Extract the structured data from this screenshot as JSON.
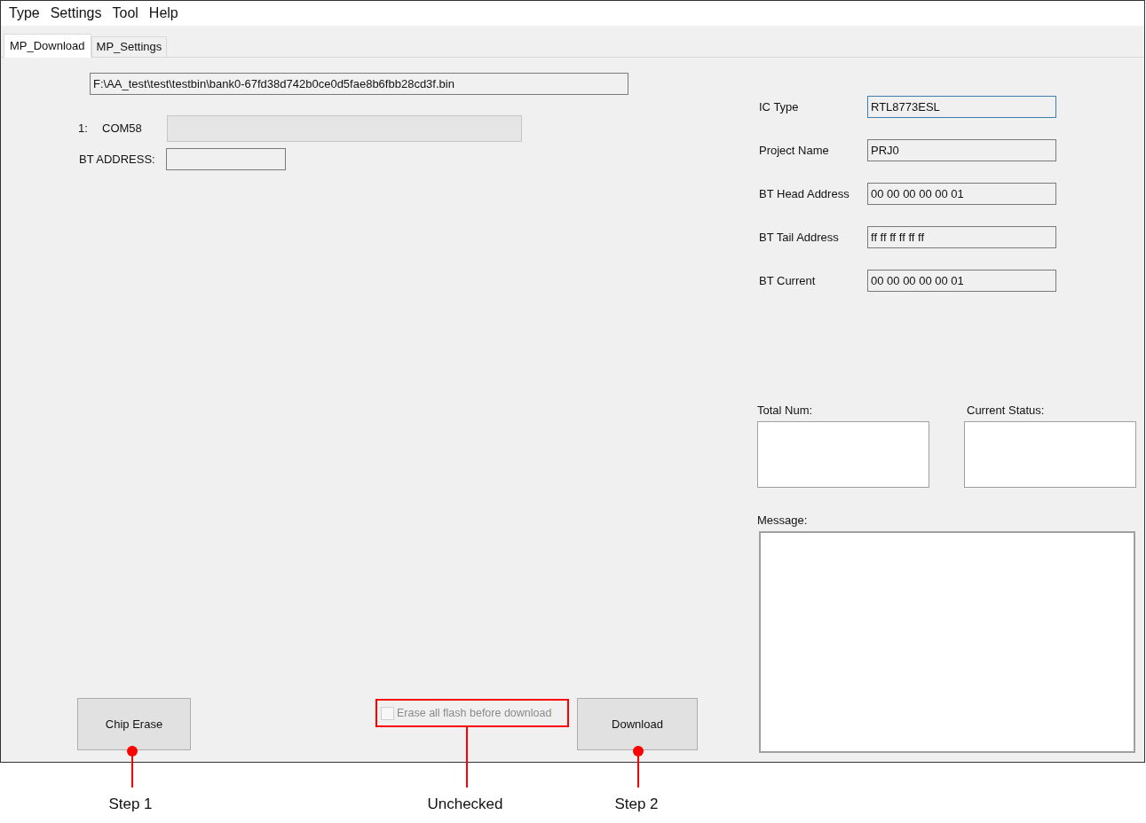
{
  "menu": [
    "Type",
    "Settings",
    "Tool",
    "Help"
  ],
  "tabs": [
    {
      "label": "MP_Download",
      "selected": true
    },
    {
      "label": "MP_Settings",
      "selected": false
    }
  ],
  "file_path": "F:\\AA_test\\test\\testbin\\bank0-67fd38d742b0ce0d5fae8b6fbb28cd3f.bin",
  "port": {
    "index": "1:",
    "name": "COM58"
  },
  "bt_address": {
    "label": "BT ADDRESS:"
  },
  "fields": [
    {
      "label": "IC Type",
      "value": "RTL8773ESL",
      "focused": true
    },
    {
      "label": "Project Name",
      "value": "PRJ0",
      "focused": false
    },
    {
      "label": "BT Head Address",
      "value": "00 00 00 00 00 01",
      "focused": false
    },
    {
      "label": "BT Tail Address",
      "value": "ff ff ff ff ff ff",
      "focused": false
    },
    {
      "label": "BT Current",
      "value": "00 00 00 00 00 01",
      "focused": false
    }
  ],
  "total_num": {
    "label": "Total Num:"
  },
  "current_status": {
    "label": "Current Status:"
  },
  "message": {
    "label": "Message:"
  },
  "chip_erase_button": "Chip Erase",
  "erase_checkbox": {
    "label": "Erase all flash before download",
    "checked": false,
    "disabled": true
  },
  "download_button": "Download",
  "annotations": [
    "Step 1",
    "Unchecked",
    "Step 2"
  ]
}
